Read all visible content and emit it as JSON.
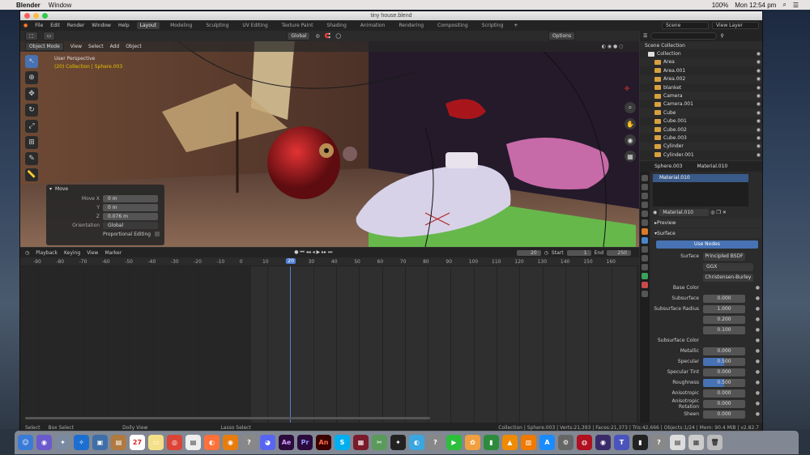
{
  "mac": {
    "app": "Blender",
    "menu": [
      "Window"
    ],
    "battery": "100%",
    "clock": "Mon 12:54 pm"
  },
  "window": {
    "title": "tiny house.blend"
  },
  "topbar": {
    "menus": [
      "File",
      "Edit",
      "Render",
      "Window",
      "Help"
    ],
    "workspaces": [
      "Layout",
      "Modeling",
      "Sculpting",
      "UV Editing",
      "Texture Paint",
      "Shading",
      "Animation",
      "Rendering",
      "Compositing",
      "Scripting"
    ],
    "scene": "Scene",
    "view_layer": "View Layer"
  },
  "viewport": {
    "mode": "Object Mode",
    "menus": [
      "View",
      "Select",
      "Add",
      "Object"
    ],
    "orientation": "Global",
    "options": "Options",
    "perspective": "User Perspective",
    "collection_info": "(20) Collection | Sphere.003"
  },
  "move_panel": {
    "title": "Move",
    "rows": [
      {
        "label": "Move X",
        "value": "0 m"
      },
      {
        "label": "Y",
        "value": "0 m"
      },
      {
        "label": "Z",
        "value": "0.076 m"
      },
      {
        "label": "Orientation",
        "value": "Global"
      }
    ],
    "proportional": "Proportional Editing"
  },
  "timeline": {
    "menus": [
      "Playback",
      "Keying",
      "View",
      "Marker"
    ],
    "current_frame": "20",
    "start_label": "Start",
    "start": "1",
    "end_label": "End",
    "end": "250",
    "ticks": [
      "-90",
      "-80",
      "-70",
      "-60",
      "-50",
      "-40",
      "-30",
      "-20",
      "-10",
      "0",
      "10",
      "20",
      "30",
      "40",
      "50",
      "60",
      "70",
      "80",
      "90",
      "100",
      "110",
      "120",
      "130",
      "140",
      "150",
      "160"
    ]
  },
  "status": {
    "select": "Select",
    "box_select": "Box Select",
    "dolly": "Dolly View",
    "lasso": "Lasso Select",
    "info": "Collection | Sphere.003 | Verts:21,393 | Faces:21,373 | Tris:42,666 | Objects:1/24 | Mem: 90.4 MiB | v2.82.7"
  },
  "outliner": {
    "title": "Scene Collection",
    "items": [
      "Collection",
      "Area",
      "Area.001",
      "Area.002",
      "blanket",
      "Camera",
      "Camera.001",
      "Cube",
      "Cube.001",
      "Cube.002",
      "Cube.003",
      "Cylinder",
      "Cylinder.001"
    ]
  },
  "properties": {
    "object": "Sphere.003",
    "material": "Material.010",
    "slot": "Material.010",
    "material_field": "Material.010",
    "preview": "Preview",
    "surface_section": "Surface",
    "use_nodes": "Use Nodes",
    "surface": "Principled BSDF",
    "distribution": "GGX",
    "subsurface_method": "Christensen-Burley",
    "rows": [
      {
        "label": "Base Color",
        "value": ""
      },
      {
        "label": "Subsurface",
        "value": "0.000"
      },
      {
        "label": "Subsurface Radius",
        "value": "1.000"
      },
      {
        "label": "",
        "value": "0.200"
      },
      {
        "label": "",
        "value": "0.100"
      },
      {
        "label": "Subsurface Color",
        "value": ""
      },
      {
        "label": "Metallic",
        "value": "0.000"
      },
      {
        "label": "Specular",
        "value": "0.500"
      },
      {
        "label": "Specular Tint",
        "value": "0.000"
      },
      {
        "label": "Roughness",
        "value": "0.500"
      },
      {
        "label": "Anisotropic",
        "value": "0.000"
      },
      {
        "label": "Anisotropic Rotation",
        "value": "0.000"
      },
      {
        "label": "Sheen",
        "value": "0.000"
      }
    ]
  },
  "colors": {
    "accent": "#4772b3",
    "active_text": "#e8c100"
  }
}
